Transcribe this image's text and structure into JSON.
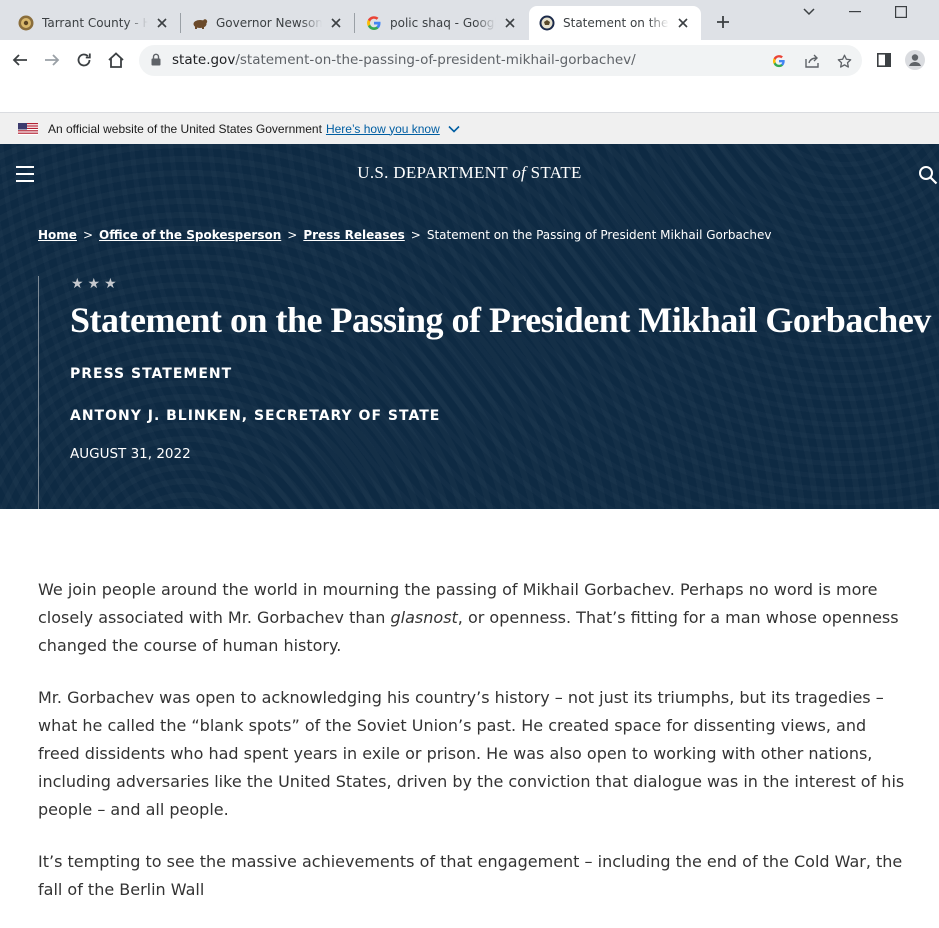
{
  "browser": {
    "tabs": [
      {
        "title": "Tarrant County - Home",
        "icon": "county-seal-icon",
        "active": false
      },
      {
        "title": "Governor Newsom Signs",
        "icon": "california-bear-icon",
        "active": false
      },
      {
        "title": "polic shaq - Google Search",
        "icon": "google-icon",
        "active": false
      },
      {
        "title": "Statement on the Passing",
        "icon": "state-seal-icon",
        "active": true
      }
    ],
    "url_host": "state.gov",
    "url_path": "/statement-on-the-passing-of-president-mikhail-gorbachev/"
  },
  "gov_banner": {
    "text": "An official website of the United States Government",
    "link": "Here’s how you know"
  },
  "site": {
    "title_pre": "U.S. DEPARTMENT ",
    "title_of": "of",
    "title_post": " STATE"
  },
  "breadcrumb": {
    "items": [
      "Home",
      "Office of the Spokesperson",
      "Press Releases"
    ],
    "current": "Statement on the Passing of President Mikhail Gorbachev",
    "sep": ">"
  },
  "article": {
    "stars": "★★★",
    "headline": "Statement on the Passing of President Mikhail Gorbachev",
    "type": "PRESS STATEMENT",
    "byline": "ANTONY J. BLINKEN, SECRETARY OF STATE",
    "date": "AUGUST 31, 2022",
    "p1_a": "We join people around the world in mourning the passing of Mikhail Gorbachev. Perhaps no word is more closely associated with Mr. Gorbachev than ",
    "p1_em": "glasnost",
    "p1_b": ", or openness. That’s fitting for a man whose openness changed the course of human history.",
    "p2": "Mr. Gorbachev was open to acknowledging his country’s history – not just its triumphs, but its tragedies – what he called the “blank spots” of the Soviet Union’s past. He created space for dissenting views, and freed dissidents who had spent years in exile or prison. He was also open to working with other nations, including adversaries like the United States, driven by the conviction that dialogue was in the interest of his people – and all people.",
    "p3": "It’s tempting to see the massive achievements of that engagement – including the end of the Cold War, the fall of the Berlin Wall"
  }
}
